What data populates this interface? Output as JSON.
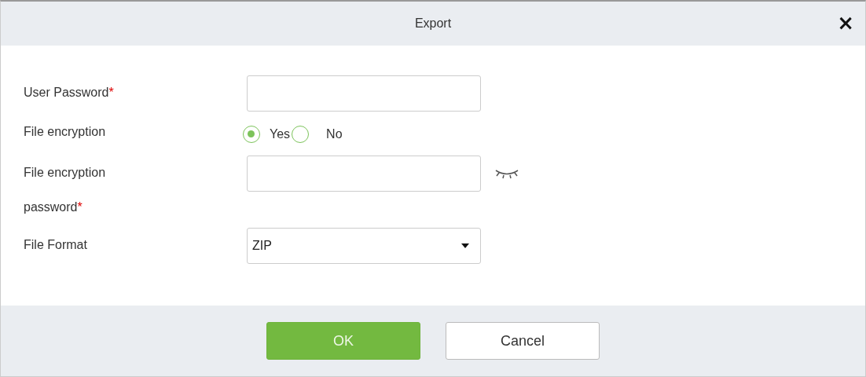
{
  "dialog": {
    "title": "Export",
    "close": "×"
  },
  "fields": [
    {
      "kind": "text",
      "label": "User Password",
      "mark": "*"
    },
    {
      "kind": "radio",
      "label": "File encryption",
      "options": [
        {
          "label": "Yes",
          "selected": true
        },
        {
          "label": "No",
          "selected": false
        }
      ]
    },
    {
      "kind": "password",
      "label": "File encryption password",
      "mark": "*"
    },
    {
      "kind": "select",
      "label": "File Format",
      "value": "ZIP"
    }
  ],
  "buttons": [
    {
      "label": "OK",
      "kind": "primary"
    },
    {
      "label": "Cancel",
      "kind": "secondary"
    }
  ]
}
